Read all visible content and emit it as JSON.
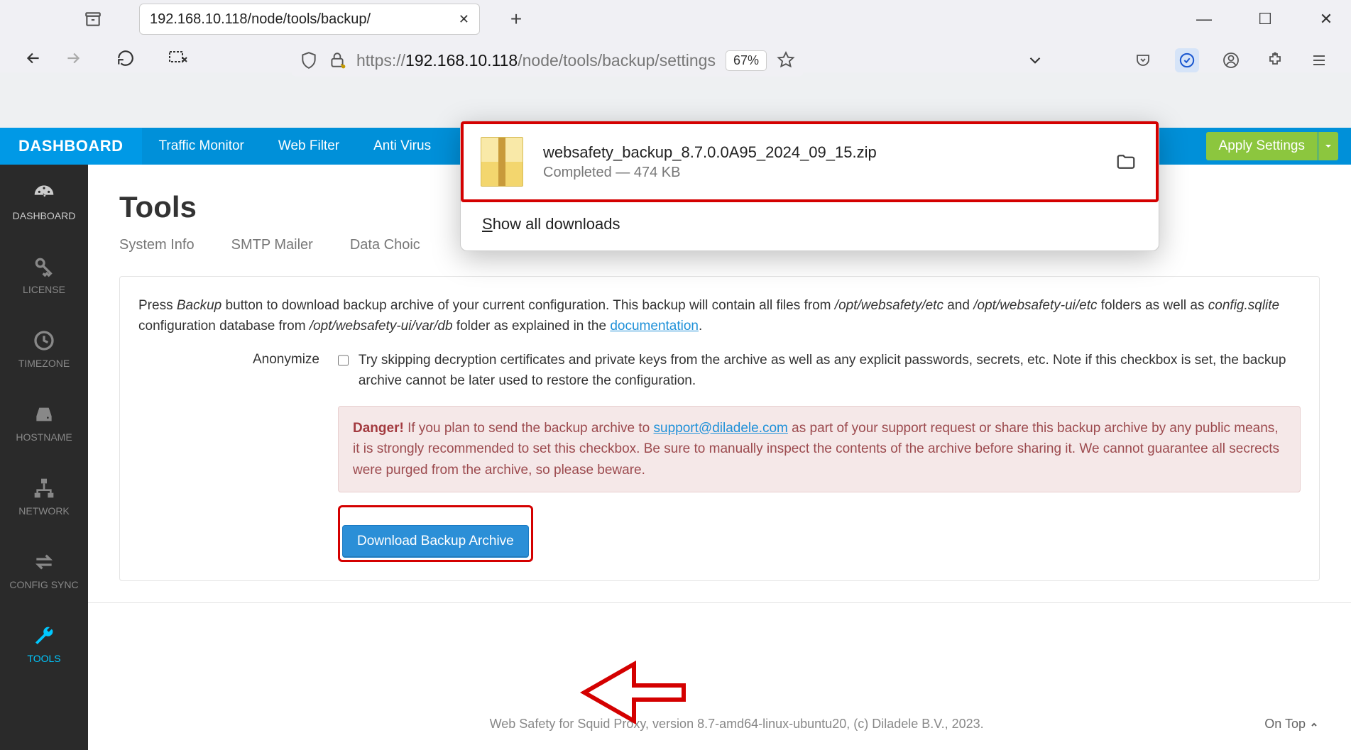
{
  "browser": {
    "tab_title": "192.168.10.118/node/tools/backup/",
    "url_prefix": "https://",
    "url_host": "192.168.10.118",
    "url_path": "/node/tools/backup/settings",
    "zoom": "67%"
  },
  "download_popup": {
    "filename": "websafety_backup_8.7.0.0A95_2024_09_15.zip",
    "status": "Completed — 474 KB",
    "show_all": "Show all downloads"
  },
  "topnav": {
    "brand": "DASHBOARD",
    "items": [
      "Traffic Monitor",
      "Web Filter",
      "Anti Virus"
    ],
    "apply": "Apply Settings"
  },
  "sidebar": {
    "items": [
      {
        "label": "DASHBOARD"
      },
      {
        "label": "LICENSE"
      },
      {
        "label": "TIMEZONE"
      },
      {
        "label": "HOSTNAME"
      },
      {
        "label": "NETWORK"
      },
      {
        "label": "CONFIG SYNC"
      },
      {
        "label": "TOOLS"
      }
    ]
  },
  "page": {
    "title": "Tools",
    "tabs": [
      "System Info",
      "SMTP Mailer",
      "Data Choic"
    ],
    "intro_1a": "Press ",
    "intro_1b": "Backup",
    "intro_1c": " button to download backup archive of your current configuration. This backup will contain all files from ",
    "intro_1d": "/opt/websafety/etc",
    "intro_1e": " and ",
    "intro_1f": "/opt/websafety-ui/etc",
    "intro_1g": " folders as well as ",
    "intro_1h": "config.sqlite",
    "intro_1i": " configuration database from ",
    "intro_1j": "/opt/websafety-ui/var/db",
    "intro_1k": " folder as explained in the ",
    "intro_1l": "documentation",
    "intro_1m": ".",
    "anonymize_label": "Anonymize",
    "anonymize_text": "Try skipping decryption certificates and private keys from the archive as well as any explicit passwords, secrets, etc. Note if this checkbox is set, the backup archive cannot be later used to restore the configuration.",
    "danger_b": "Danger!",
    "danger_1": " If you plan to send the backup archive to ",
    "danger_email": "support@diladele.com",
    "danger_2": " as part of your support request or share this backup archive by any public means, it is strongly recommended to set this checkbox. Be sure to manually inspect the contents of the archive before sharing it. We cannot guarantee all secrects were purged from the archive, so please beware.",
    "download_btn": "Download Backup Archive",
    "footer": "Web Safety for Squid Proxy, version 8.7-amd64-linux-ubuntu20, (c) Diladele B.V., 2023.",
    "ontop": "On Top"
  }
}
